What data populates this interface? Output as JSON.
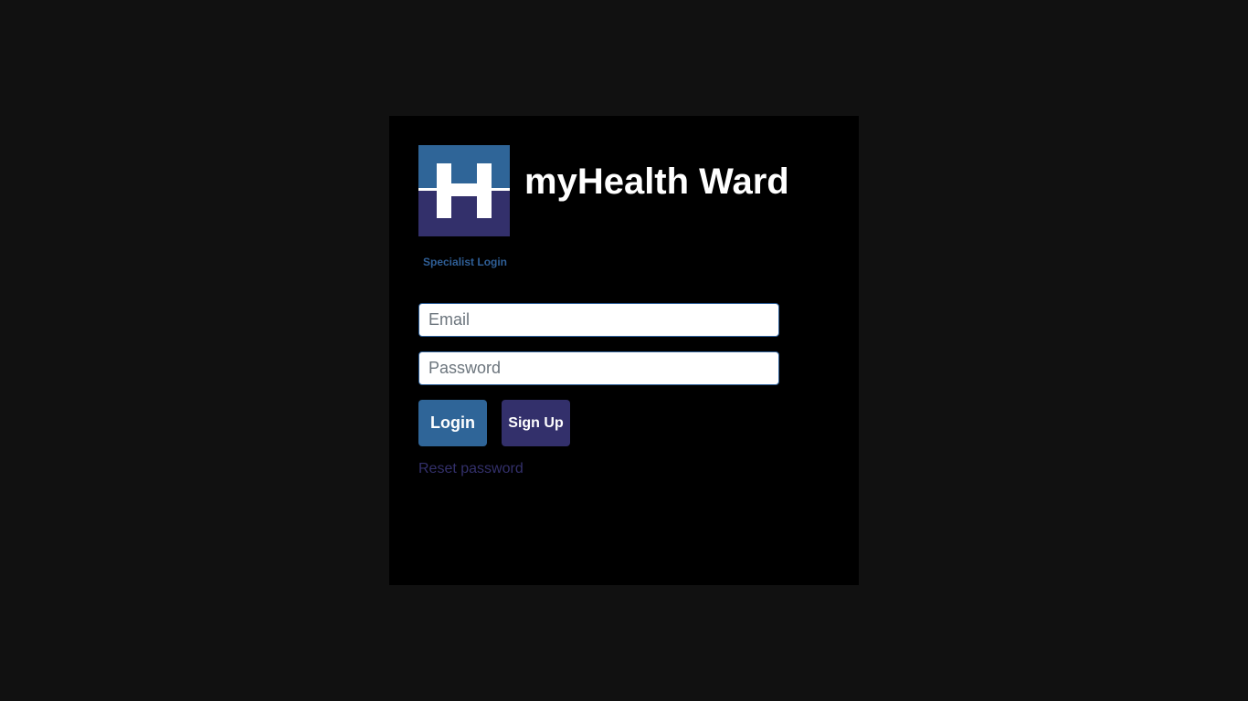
{
  "app": {
    "title": "myHealth Ward",
    "subtitle": "Specialist Login"
  },
  "logo": {
    "icon": "hospital-h-icon",
    "top_color": "#2f6598",
    "bottom_color": "#33306b"
  },
  "form": {
    "email_placeholder": "Email",
    "email_value": "",
    "password_placeholder": "Password",
    "password_value": ""
  },
  "buttons": {
    "login_label": "Login",
    "signup_label": "Sign Up"
  },
  "links": {
    "reset_password": "Reset password"
  },
  "colors": {
    "page_background": "#111111",
    "card_background": "#000000",
    "accent_blue": "#2f6598",
    "accent_purple": "#33306b"
  }
}
